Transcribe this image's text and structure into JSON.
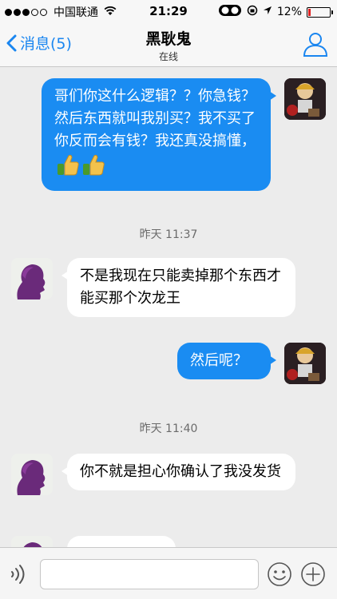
{
  "status_bar": {
    "signal_bars_filled": 3,
    "signal_bars_total": 5,
    "carrier": "中国联通",
    "time": "21:29",
    "battery": "12%",
    "battery_level": 0.12,
    "battery_color": "#e02020"
  },
  "nav": {
    "back_label": "消息(5)",
    "title": "黑耿鬼",
    "subtitle": "在线",
    "accent_color": "#1a86f0"
  },
  "messages": [
    {
      "direction": "out",
      "text": "哥们你这什么逻辑？？你急钱？然后东西就叫我别买？我不买了你反而会有钱？我还真没搞懂，",
      "emoji": [
        "thumbs-up-icon",
        "thumbs-up-icon"
      ]
    },
    {
      "direction": "time",
      "text": "昨天 11:37"
    },
    {
      "direction": "in",
      "text": "不是我现在只能卖掉那个东西才能买那个次龙王"
    },
    {
      "direction": "out",
      "text": "然后呢？"
    },
    {
      "direction": "time",
      "text": "昨天 11:40"
    },
    {
      "direction": "in",
      "text": "你不就是担心你确认了我没发货"
    }
  ],
  "input": {
    "value": "",
    "placeholder": "",
    "icons": [
      "voice-icon",
      "emoji-icon",
      "plus-icon"
    ]
  },
  "colors": {
    "outgoing_bubble": "#1a8cf2",
    "incoming_bubble": "#ffffff",
    "background": "#ececec"
  }
}
